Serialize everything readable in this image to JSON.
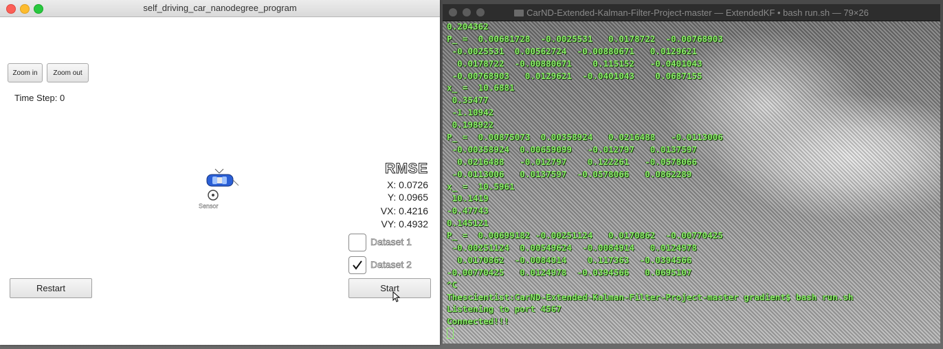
{
  "simulator": {
    "window_title": "self_driving_car_nanodegree_program",
    "zoom_in_label": "Zoom in",
    "zoom_out_label": "Zoom out",
    "time_step_label": "Time Step:",
    "time_step_value": "0",
    "car_tag": "Sensor",
    "rmse": {
      "title": "RMSE",
      "x": "X: 0.0726",
      "y": "Y: 0.0965",
      "vx": "VX: 0.4216",
      "vy": "VY: 0.4932"
    },
    "datasets": [
      {
        "label": "Dataset 1",
        "checked": false
      },
      {
        "label": "Dataset 2",
        "checked": true
      }
    ],
    "restart_label": "Restart",
    "start_label": "Start"
  },
  "terminal": {
    "window_title": "CarND-Extended-Kalman-Filter-Project-master — ExtendedKF • bash run.sh — 79×26",
    "lines": [
      "0.204362",
      "P_ =  0.00681728  -0.0025531   0.0178722  -0.00768903",
      " -0.0025531  0.00562724  -0.00880671   0.0129621",
      "  0.0178722  -0.00880671    0.115152   -0.0401043",
      " -0.00768903   0.0129621  -0.0401043    0.0687155",
      "x_ =  10.6881",
      " 0.35477",
      " -1.10942",
      " 0.198922",
      "P_ =  0.00875073  0.00358924   0.0216488   -0.0113006",
      " -0.00358924  0.00659099   -0.012797   0.0137597",
      "  0.0216488   -0.012797    0.122261   -0.0578066",
      " -0.0113006   0.0137597  -0.0578066   0.0862289",
      "x_ =  10.5961",
      " 10.1419",
      "-0.47743",
      "0.145121",
      "P_ =  0.00699182 -0.00251124   0.0170862  -0.00770425",
      " -0.00251124  0.00549624  -0.0084914   0.0124978",
      "  0.0170862  -0.0084914    0.117363  -0.0394566",
      "-0.00770425   0.0124978  -0.0394566   0.0695107",
      "^C",
      "Thescientist:CarND-Extended-Kalman-Filter-Project-master gradient$ bash run.sh",
      "Listening to port 4567",
      "Connected!!!"
    ]
  },
  "colors": {
    "terminal_text": "#8cf06a",
    "car_blue": "#2a5fd6",
    "close_red": "#fc5f57",
    "min_yellow": "#fdbc2e",
    "max_green": "#29c840"
  }
}
